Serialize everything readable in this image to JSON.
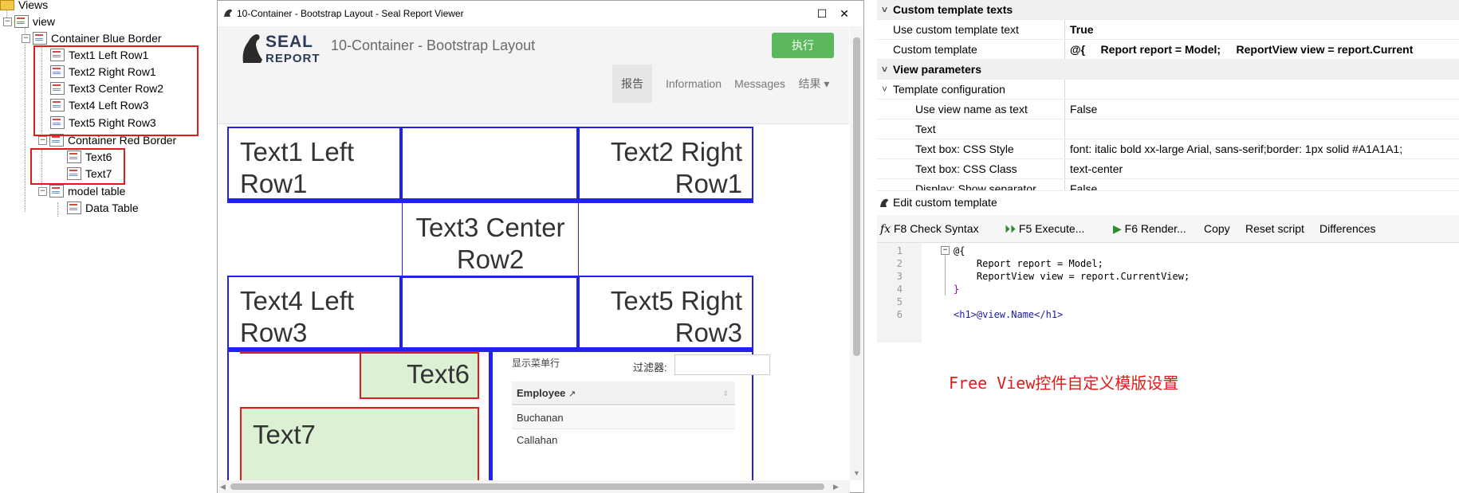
{
  "tree": {
    "root": "Views",
    "view": "view",
    "container_blue": "Container Blue Border",
    "blue_items": [
      "Text1 Left Row1",
      "Text2 Right Row1",
      "Text3 Center Row2",
      "Text4 Left Row3",
      "Text5 Right Row3"
    ],
    "container_red": "Container Red Border",
    "red_items": [
      "Text6",
      "Text7"
    ],
    "model_table": "model table",
    "data_table": "Data Table"
  },
  "viewer": {
    "window_title": "10-Container - Bootstrap Layout - Seal Report Viewer",
    "logo_top": "SEAL",
    "logo_bottom": "REPORT",
    "report_title": "10-Container - Bootstrap Layout",
    "execute_label": "执行",
    "tabs": [
      "报告",
      "Information",
      "Messages",
      "结果 ▾"
    ],
    "active_tab": "报告",
    "texts": {
      "t1": "Text1 Left Row1",
      "t2": "Text2 Right Row1",
      "t3": "Text3 Center Row2",
      "t4": "Text4 Left Row3",
      "t5": "Text5 Right Row3",
      "t6": "Text6",
      "t7": "Text7"
    },
    "table": {
      "show_rows_label": "显示菜单行",
      "filter_label": "过滤器:",
      "filter_value": "",
      "column": "Employee",
      "rows": [
        "Buchanan",
        "Callahan"
      ]
    }
  },
  "properties": {
    "categories": [
      "Custom template texts",
      "View parameters"
    ],
    "rows": [
      {
        "name": "Use custom template text",
        "value": "True",
        "bold": true
      },
      {
        "name": "Custom template",
        "value": "@{     Report report = Model;     ReportView view = report.Current",
        "bold": true
      },
      {
        "name": "Template configuration",
        "value": ""
      },
      {
        "name": "Use view name as text",
        "value": "False"
      },
      {
        "name": "Text",
        "value": ""
      },
      {
        "name": "Text box: CSS Style",
        "value": "font: italic bold xx-large Arial, sans-serif;border: 1px solid #A1A1A1;"
      },
      {
        "name": "Text box: CSS Class",
        "value": "text-center"
      },
      {
        "name": "Display: Show separator",
        "value": "False"
      }
    ]
  },
  "editor": {
    "title": "Edit custom template",
    "toolbar": {
      "check": "F8 Check Syntax",
      "execute": "F5 Execute...",
      "render": "F6 Render...",
      "copy": "Copy",
      "reset": "Reset script",
      "diff": "Differences"
    },
    "line_numbers": [
      "1",
      "2",
      "3",
      "4",
      "5",
      "6"
    ],
    "code": [
      "@{",
      "    Report report = Model;",
      "    ReportView view = report.CurrentView;",
      "}",
      "",
      "<h1>@view.Name</h1>"
    ]
  },
  "caption": "Free View控件自定义模版设置",
  "colors": {
    "blue_border": "#2222ee",
    "red_border": "#e01b1b",
    "exec_green": "#5cb85c",
    "cell_green": "#dcf0d4"
  }
}
